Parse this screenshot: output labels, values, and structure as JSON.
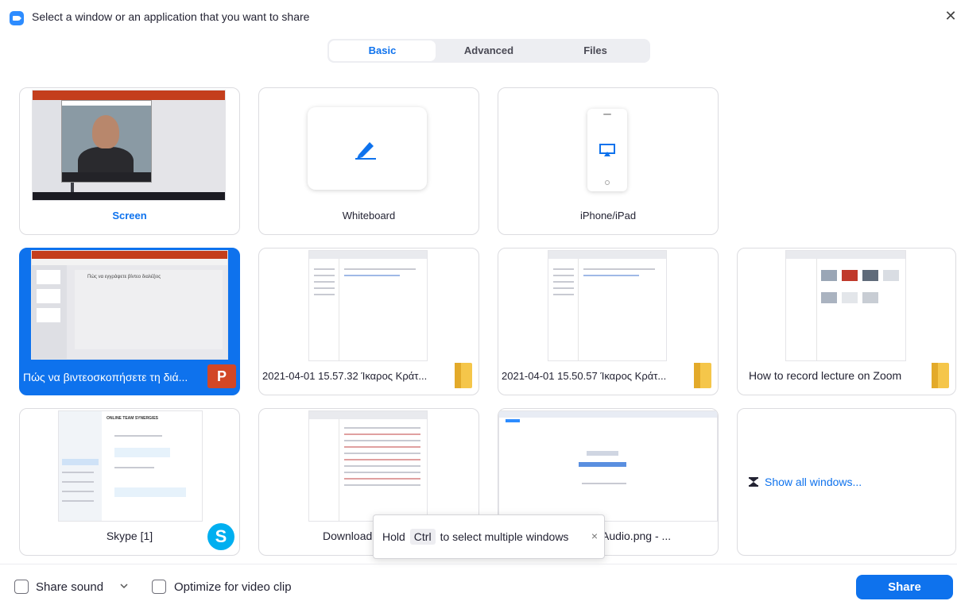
{
  "window": {
    "title": "Select a window or an application that you want to share",
    "close_glyph": "✕"
  },
  "tabs": [
    {
      "label": "Basic",
      "active": true
    },
    {
      "label": "Advanced",
      "active": false
    },
    {
      "label": "Files",
      "active": false
    }
  ],
  "tiles": {
    "screen": {
      "label": "Screen"
    },
    "whiteboard": {
      "label": "Whiteboard",
      "icon": "pen-icon"
    },
    "iphone": {
      "label": "iPhone/iPad",
      "icon": "airplay-icon"
    },
    "ppt": {
      "label": "Πώς να βιντεοσκοπήσετε τη διά...",
      "icon": "powerpoint-icon",
      "icon_text": "P",
      "selected": true,
      "slide_text": "Πώς να εγγράψετε βίντεο διαλέξεις"
    },
    "folder1": {
      "label": "2021-04-01 15.57.32 Ίκαρος Κράτ...",
      "icon": "folder-icon"
    },
    "folder2": {
      "label": "2021-04-01 15.50.57 Ίκαρος Κράτ...",
      "icon": "folder-icon"
    },
    "folder3": {
      "label": "How to record lecture on Zoom",
      "icon": "folder-icon"
    },
    "skype": {
      "label": "Skype [1]",
      "icon": "skype-icon",
      "icon_text": "S",
      "thumb_title": "ONLINE TEAM SYNERGIES"
    },
    "downloads": {
      "label": "Download"
    },
    "audio": {
      "label": "Audio.png - ..."
    },
    "show_all": {
      "label": "Show all windows...",
      "icon": "hourglass-icon"
    }
  },
  "tooltip": {
    "pre": "Hold",
    "key": "Ctrl",
    "post": "to select multiple windows",
    "close_glyph": "×"
  },
  "footer": {
    "share_sound": "Share sound",
    "optimize": "Optimize for video clip",
    "share_button": "Share"
  },
  "colors": {
    "accent": "#0e72ed",
    "ppt": "#d24726",
    "skype": "#00aff0",
    "folder": "#f5c64a"
  }
}
